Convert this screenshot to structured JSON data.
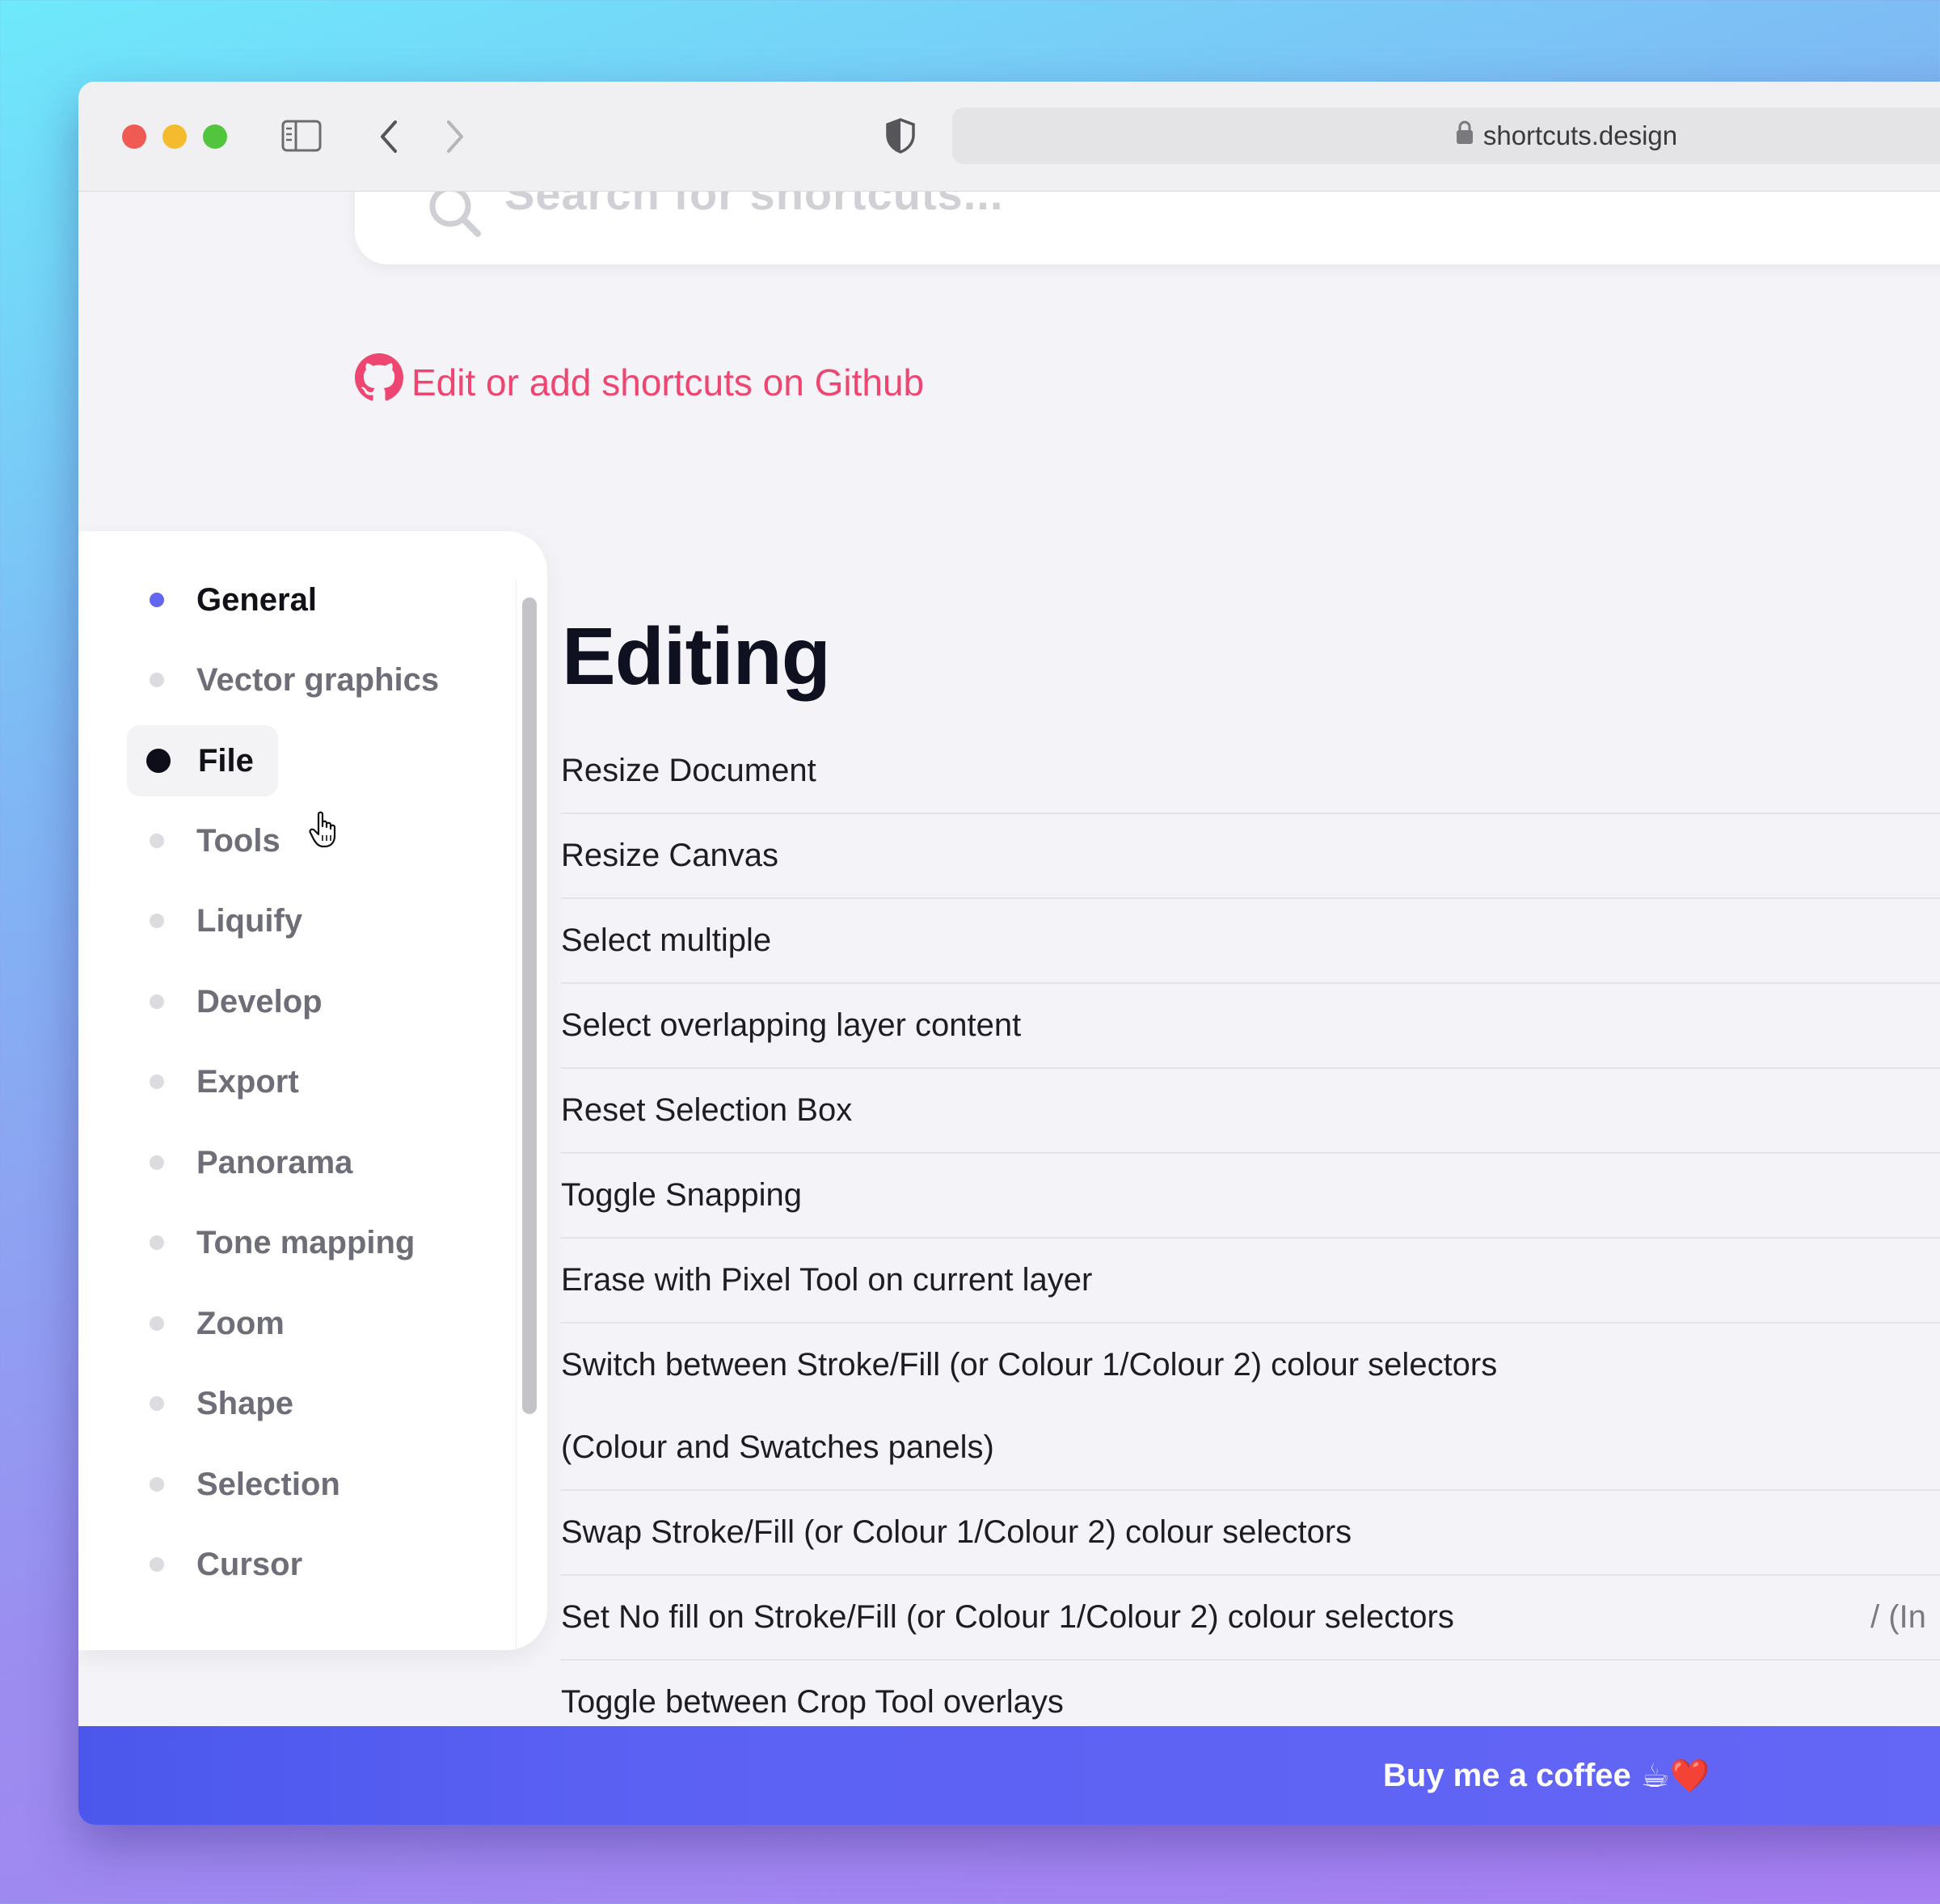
{
  "browser": {
    "url": "shortcuts.design"
  },
  "search": {
    "placeholder": "Search for shortcuts..."
  },
  "github_link": {
    "label": "Edit or add shortcuts on Github"
  },
  "sidebar": {
    "items": [
      {
        "label": "General"
      },
      {
        "label": "Vector graphics"
      },
      {
        "label": "File"
      },
      {
        "label": "Tools"
      },
      {
        "label": "Liquify"
      },
      {
        "label": "Develop"
      },
      {
        "label": "Export"
      },
      {
        "label": "Panorama"
      },
      {
        "label": "Tone mapping"
      },
      {
        "label": "Zoom"
      },
      {
        "label": "Shape"
      },
      {
        "label": "Selection"
      },
      {
        "label": "Cursor"
      }
    ]
  },
  "main": {
    "title": "Editing",
    "rows": [
      {
        "label": "Resize Document"
      },
      {
        "label": "Resize Canvas"
      },
      {
        "label": "Select multiple"
      },
      {
        "label": "Select overlapping layer content"
      },
      {
        "label": "Reset Selection Box"
      },
      {
        "label": "Toggle Snapping"
      },
      {
        "label": "Erase with Pixel Tool on current layer"
      },
      {
        "label": "Switch between Stroke/Fill (or Colour 1/Colour 2) colour selectors (Colour and Swatches panels)"
      },
      {
        "label": "Swap Stroke/Fill (or Colour 1/Colour 2) colour selectors"
      },
      {
        "label": "Set No fill on Stroke/Fill (or Colour 1/Colour 2) colour selectors",
        "right": "/ (In"
      },
      {
        "label": "Toggle between Crop Tool overlays"
      }
    ]
  },
  "footer": {
    "coffee_label": "Buy me a coffee",
    "coffee_emoji": "☕❤️"
  },
  "colors": {
    "accent": "#6366f1",
    "link": "#ee4670",
    "footer": "#5b61f3"
  }
}
